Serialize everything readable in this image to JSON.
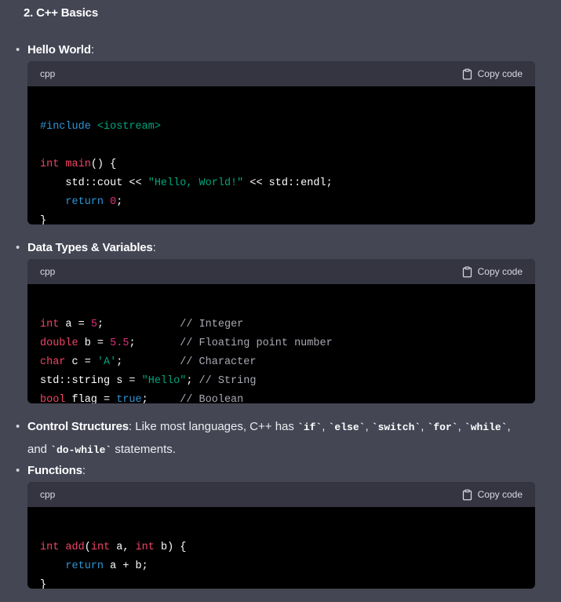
{
  "heading": "2. C++ Basics",
  "copy_label": "Copy code",
  "sections": {
    "hello": {
      "title": "Hello World",
      "colon": ":",
      "lang": "cpp",
      "lines": [
        [],
        [
          [
            "pre",
            "#include"
          ],
          [
            "plain",
            " "
          ],
          [
            "str",
            "<iostream>"
          ]
        ],
        [],
        [
          [
            "kw",
            "int"
          ],
          [
            "plain",
            " "
          ],
          [
            "kw",
            "main"
          ],
          [
            "plain",
            "() {"
          ]
        ],
        [
          [
            "plain",
            "    std::cout << "
          ],
          [
            "str",
            "\"Hello, World!\""
          ],
          [
            "plain",
            " << std::endl;"
          ]
        ],
        [
          [
            "plain",
            "    "
          ],
          [
            "blue",
            "return"
          ],
          [
            "plain",
            " "
          ],
          [
            "num",
            "0"
          ],
          [
            "plain",
            ";"
          ]
        ],
        [
          [
            "plain",
            "}"
          ]
        ]
      ]
    },
    "types": {
      "title": "Data Types & Variables",
      "colon": ":",
      "lang": "cpp",
      "lines": [
        [],
        [
          [
            "kw",
            "int"
          ],
          [
            "plain",
            " a = "
          ],
          [
            "num",
            "5"
          ],
          [
            "plain",
            ";            "
          ],
          [
            "cmt",
            "// Integer"
          ]
        ],
        [
          [
            "kw",
            "double"
          ],
          [
            "plain",
            " b = "
          ],
          [
            "num",
            "5.5"
          ],
          [
            "plain",
            ";       "
          ],
          [
            "cmt",
            "// Floating point number"
          ]
        ],
        [
          [
            "kw",
            "char"
          ],
          [
            "plain",
            " c = "
          ],
          [
            "str",
            "'A'"
          ],
          [
            "plain",
            ";         "
          ],
          [
            "cmt",
            "// Character"
          ]
        ],
        [
          [
            "plain",
            "std::string s = "
          ],
          [
            "str",
            "\"Hello\""
          ],
          [
            "plain",
            "; "
          ],
          [
            "cmt",
            "// String"
          ]
        ],
        [
          [
            "kw",
            "bool"
          ],
          [
            "plain",
            " flag = "
          ],
          [
            "blue",
            "true"
          ],
          [
            "plain",
            ";     "
          ],
          [
            "cmt",
            "// Boolean"
          ]
        ]
      ]
    },
    "control": {
      "title": "Control Structures",
      "text1": ": Like most languages, C++ has ",
      "codes": [
        "`if`",
        "`else`",
        "`switch`",
        "`for`",
        "`while`",
        "`do-while`"
      ],
      "sep": ", ",
      "and": "and ",
      "end": " statements."
    },
    "functions": {
      "title": "Functions",
      "colon": ":",
      "lang": "cpp",
      "lines": [
        [],
        [
          [
            "kw",
            "int"
          ],
          [
            "plain",
            " "
          ],
          [
            "kw",
            "add"
          ],
          [
            "plain",
            "("
          ],
          [
            "kw",
            "int"
          ],
          [
            "plain",
            " a, "
          ],
          [
            "kw",
            "int"
          ],
          [
            "plain",
            " b) {"
          ]
        ],
        [
          [
            "plain",
            "    "
          ],
          [
            "blue",
            "return"
          ],
          [
            "plain",
            " a + b;"
          ]
        ],
        [
          [
            "plain",
            "}"
          ]
        ]
      ]
    }
  },
  "colors": {
    "background": "#444654",
    "code_bg": "#000000",
    "code_header_bg": "#343541",
    "keyword": "#ef4465",
    "builtin": "#2e95d3",
    "string": "#00a67d",
    "number": "#df3079",
    "comment": "#a9aab3"
  }
}
